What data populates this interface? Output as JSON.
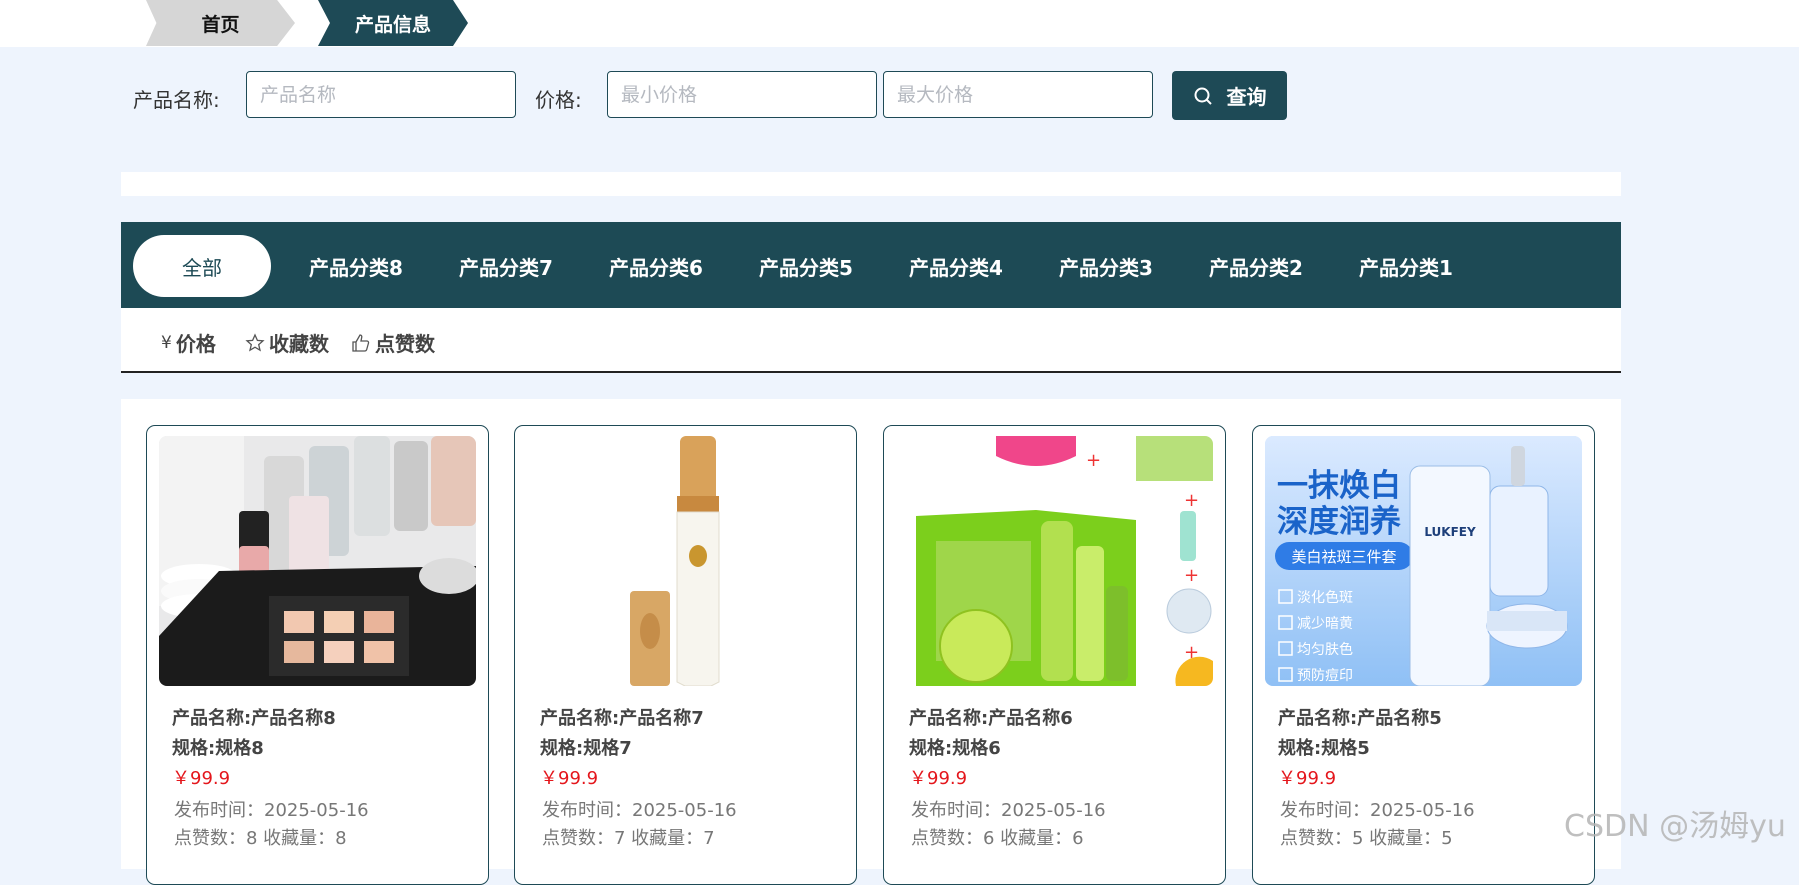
{
  "breadcrumb": {
    "home": "首页",
    "current": "产品信息"
  },
  "search": {
    "name_label": "产品名称:",
    "name_placeholder": "产品名称",
    "price_label": "价格:",
    "min_placeholder": "最小价格",
    "max_placeholder": "最大价格",
    "query_label": "查询"
  },
  "categories": [
    "全部",
    "产品分类8",
    "产品分类7",
    "产品分类6",
    "产品分类5",
    "产品分类4",
    "产品分类3",
    "产品分类2",
    "产品分类1"
  ],
  "sort": {
    "price": "价格",
    "price_symbol": "¥",
    "favorites": "收藏数",
    "likes": "点赞数"
  },
  "products": [
    {
      "name": "产品名称:产品名称8",
      "spec": "规格:规格8",
      "price": "￥99.9",
      "date": "发布时间：2025-05-16",
      "stats": "点赞数：8   收藏量：8",
      "image": "cosmetics-tray"
    },
    {
      "name": "产品名称:产品名称7",
      "spec": "规格:规格7",
      "price": "￥99.9",
      "date": "发布时间：2025-05-16",
      "stats": "点赞数：7   收藏量：7",
      "image": "serum-tube"
    },
    {
      "name": "产品名称:产品名称6",
      "spec": "规格:规格6",
      "price": "￥99.9",
      "date": "发布时间：2025-05-16",
      "stats": "点赞数：6   收藏量：6",
      "image": "green-skincare-set"
    },
    {
      "name": "产品名称:产品名称5",
      "spec": "规格:规格5",
      "price": "￥99.9",
      "date": "发布时间：2025-05-16",
      "stats": "点赞数：5   收藏量：5",
      "image": "whitening-set",
      "image_text": {
        "headline1": "一抹焕白",
        "headline2": "深度润养",
        "badge": "美白祛斑三件套",
        "checks": [
          "淡化色斑",
          "减少暗黄",
          "均匀肤色",
          "预防痘印"
        ],
        "brand": "LUKFEY"
      }
    }
  ],
  "watermark": "CSDN @汤姆yu",
  "colors": {
    "primary": "#1e4a56",
    "price": "#e4161c",
    "page_bg": "#eef4fd"
  }
}
